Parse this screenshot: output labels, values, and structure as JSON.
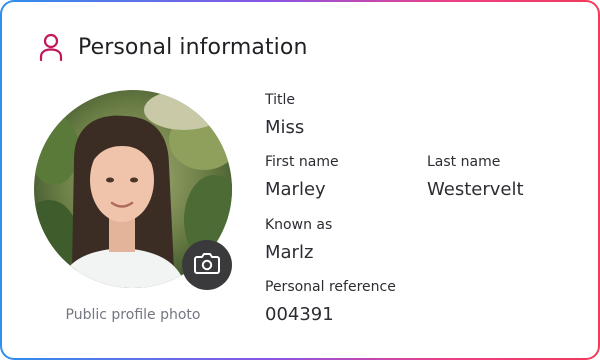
{
  "card": {
    "title": "Personal information",
    "header_icon": "user-outline-icon",
    "accent_color": "#c2185b"
  },
  "photo": {
    "caption": "Public profile photo",
    "edit_icon": "camera-icon"
  },
  "fields": {
    "title": {
      "label": "Title",
      "value": "Miss"
    },
    "first_name": {
      "label": "First name",
      "value": "Marley"
    },
    "last_name": {
      "label": "Last name",
      "value": "Westervelt"
    },
    "known_as": {
      "label": "Known as",
      "value": "Marlz"
    },
    "personal_reference": {
      "label": "Personal reference",
      "value": "004391"
    }
  }
}
